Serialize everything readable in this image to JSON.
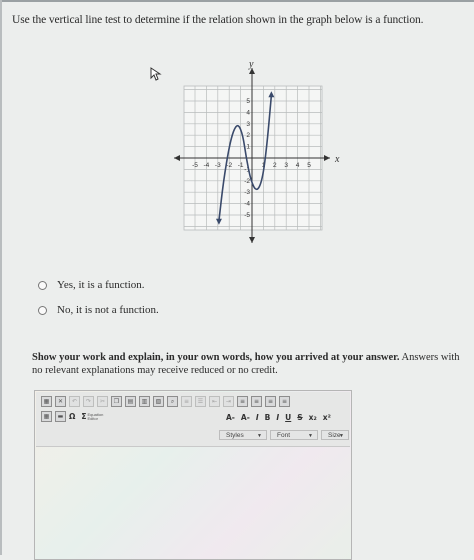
{
  "question": "Use the vertical line test to determine if the relation shown in the graph below is a function.",
  "graph": {
    "x_axis_label": "x",
    "y_axis_label": "y",
    "x_ticks": [
      "-5",
      "-4",
      "-3",
      "-2",
      "-1",
      "1",
      "2",
      "3",
      "4",
      "5"
    ],
    "y_ticks": [
      "5",
      "4",
      "3",
      "2",
      "1",
      "-1",
      "-2",
      "-3",
      "-4",
      "-5"
    ],
    "curve_color": "#3a4a6b",
    "curve_points": [
      [
        -2.9,
        -5.5
      ],
      [
        -2.5,
        -2
      ],
      [
        -2,
        1
      ],
      [
        -1.6,
        2.5
      ],
      [
        -1.2,
        3
      ],
      [
        -0.8,
        2
      ],
      [
        -0.5,
        0
      ],
      [
        -0.1,
        -2
      ],
      [
        0.4,
        -3
      ],
      [
        0.9,
        -2
      ],
      [
        1.3,
        1
      ],
      [
        1.7,
        5.5
      ]
    ]
  },
  "choices": [
    {
      "label": "Yes, it is a function."
    },
    {
      "label": "No, it is not a function."
    }
  ],
  "instructions": {
    "bold": "Show your work and explain, in your own words, how you arrived at your answer.",
    "rest": " Answers with",
    "line2": "no relevant explanations may receive reduced or no credit."
  },
  "editor": {
    "styles_label": "Styles",
    "font_label": "Font",
    "size_label": "Size",
    "equation_editor_label": "Equation Editor",
    "format_buttons": [
      "A-",
      "A-",
      "I",
      "B",
      "I",
      "U",
      "S",
      "x₂",
      "x²"
    ],
    "omega": "Ω",
    "sigma": "Σ"
  }
}
